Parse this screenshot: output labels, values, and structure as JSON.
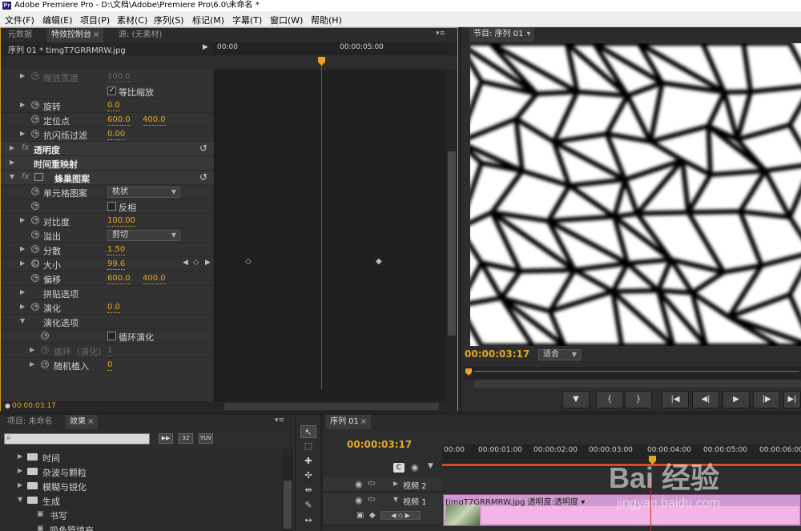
{
  "window": {
    "title": "Adobe Premiere Pro - D:\\文档\\Adobe\\Premiere Pro\\6.0\\未命名 *",
    "app_icon": "Pr"
  },
  "menu": [
    "文件(F)",
    "编辑(E)",
    "项目(P)",
    "素材(C)",
    "序列(S)",
    "标记(M)",
    "字幕(T)",
    "窗口(W)",
    "帮助(H)"
  ],
  "effect_panel": {
    "tabs": [
      "元数据",
      "特效控制台",
      "源: (无素材)"
    ],
    "sequence_label": "序列 01 * timgT7GRRMRW.jpg",
    "ruler": [
      "00:00",
      "00:00:05:00"
    ],
    "rows": [
      {
        "label": "缩放宽度",
        "value": "100.0",
        "dim": true
      },
      {
        "label": "等比缩放",
        "checkbox": true,
        "checked": true
      },
      {
        "label": "旋转",
        "value": "0.0"
      },
      {
        "label": "定位点",
        "value": "600.0",
        "value2": "400.0"
      },
      {
        "label": "抗闪烁过滤",
        "value": "0.00"
      },
      {
        "label": "透明度",
        "section": true
      },
      {
        "label": "时间重映射",
        "section": true
      },
      {
        "label": "蜂巢图案",
        "section": true
      },
      {
        "label": "单元格图案",
        "select": "枕状"
      },
      {
        "label": "反相",
        "checkbox": true,
        "checked": false
      },
      {
        "label": "对比度",
        "value": "100.00"
      },
      {
        "label": "溢出",
        "select": "剪切"
      },
      {
        "label": "分散",
        "value": "1.50"
      },
      {
        "label": "大小",
        "value": "99.6"
      },
      {
        "label": "偏移",
        "value": "600.0",
        "value2": "400.0"
      },
      {
        "label": "拼贴选项"
      },
      {
        "label": "演化",
        "value": "0.0"
      },
      {
        "label": "演化选项"
      },
      {
        "label": "循环演化",
        "checkbox": true,
        "checked": false
      },
      {
        "label": "循环（演化）",
        "value": "1",
        "dim": true
      },
      {
        "label": "随机植入",
        "value": "0"
      }
    ],
    "timecode": "00:00:03:17"
  },
  "program": {
    "tab": "节目: 序列 01",
    "timecode": "00:00:03:17",
    "fit": "适合"
  },
  "project": {
    "tabs": [
      "项目: 未命名",
      "效果"
    ],
    "icons": [
      "32",
      "YUV"
    ],
    "tree": [
      "时间",
      "杂波与颗粒",
      "模糊与锐化",
      "生成",
      "书写",
      "吸色管填充"
    ]
  },
  "sequence": {
    "tab": "序列 01",
    "timecode": "00:00:03:17",
    "ruler": [
      "00:00",
      "00:00:01:00",
      "00:00:02:00",
      "00:00:03:00",
      "00:00:04:00",
      "00:00:05:00",
      "00:00:06:00"
    ],
    "tracks": [
      "视频 2",
      "视频 1"
    ],
    "clip": "timgT7GRRMRW.jpg 透明度:透明度 ▾"
  },
  "watermark": {
    "brand": "Bai 经验",
    "url": "jingyan.baidu.com"
  },
  "colors": {
    "accent": "#e2a72a",
    "panel_border": "#d39a22",
    "playline": "#c03030",
    "clip": "#d09ad0"
  }
}
